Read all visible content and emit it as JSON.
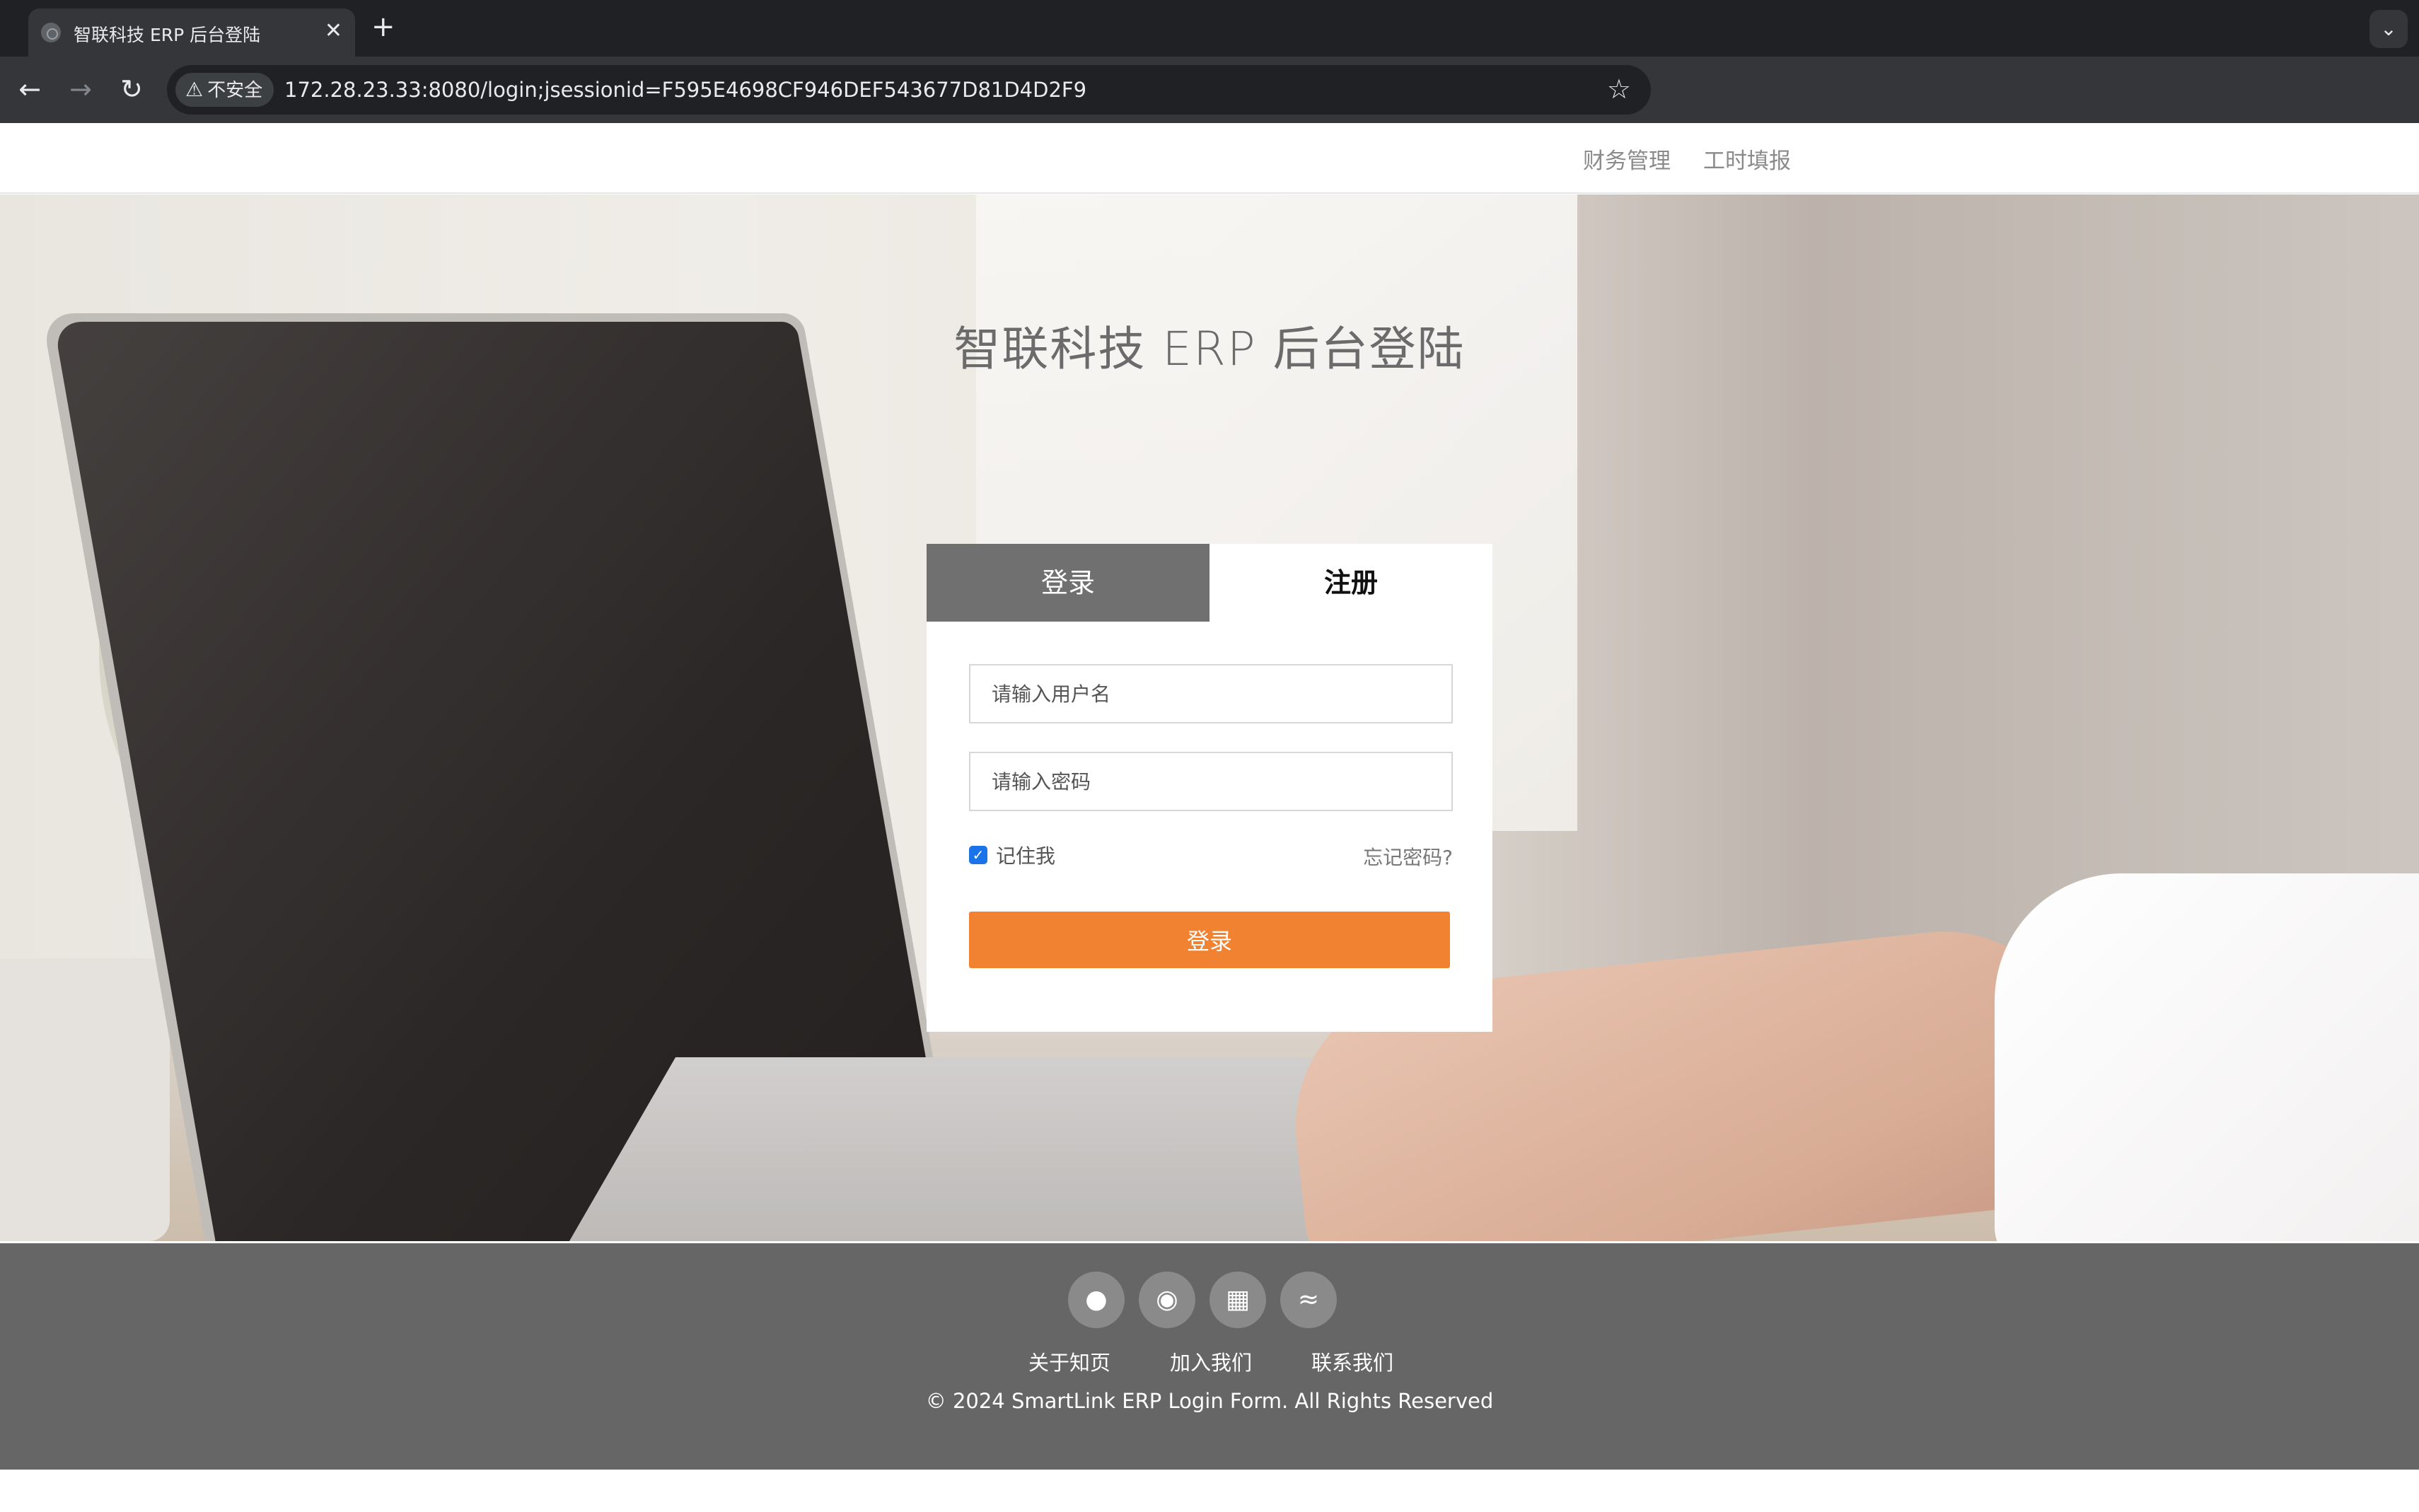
{
  "browser": {
    "tab_title": "智联科技 ERP 后台登陆",
    "close_glyph": "✕",
    "new_tab_glyph": "+",
    "security_label": "不安全",
    "url": "172.28.23.33:8080/login;jsessionid=F595E4698CF946DEF543677D81D4D2F9"
  },
  "topnav": {
    "items": [
      {
        "label": "财务管理"
      },
      {
        "label": "工时填报"
      }
    ]
  },
  "login": {
    "title": "智联科技 ERP 后台登陆",
    "tabs": [
      {
        "label": "登录",
        "active": true
      },
      {
        "label": "注册",
        "active": false
      }
    ],
    "username_placeholder": "请输入用户名",
    "password_placeholder": "请输入密码",
    "remember_label": "记住我",
    "remember_checked": true,
    "forgot_label": "忘记密码?",
    "submit_label": "登录"
  },
  "footer": {
    "social_icons": [
      "qq-icon",
      "weibo-icon",
      "qrcode-icon",
      "wifi-icon"
    ],
    "links": [
      {
        "label": "关于知页"
      },
      {
        "label": "加入我们"
      },
      {
        "label": "联系我们"
      }
    ],
    "copyright": "© 2024 SmartLink ERP Login Form. All Rights Reserved"
  },
  "colors": {
    "accent_orange": "#f08232",
    "tab_active_bg": "#707070",
    "footer_bg": "#666666"
  }
}
